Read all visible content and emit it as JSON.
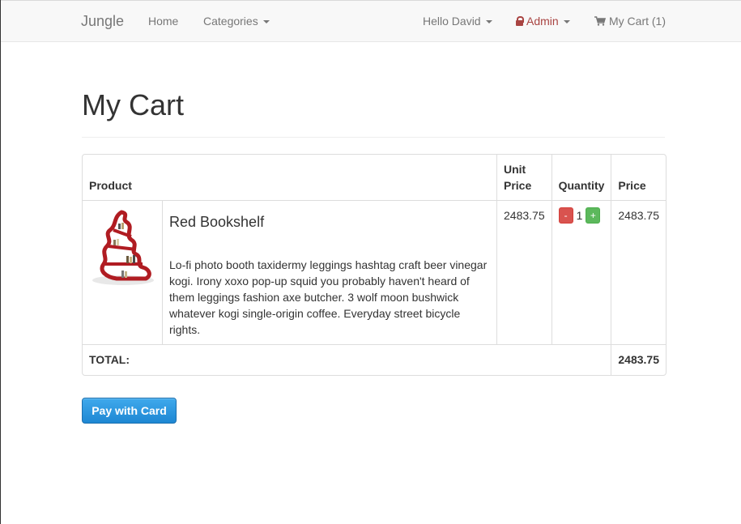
{
  "navbar": {
    "brand": "Jungle",
    "home": "Home",
    "categories": "Categories",
    "hello": "Hello David",
    "admin": "Admin",
    "cart": "My Cart (1)"
  },
  "page": {
    "title": "My Cart"
  },
  "table": {
    "headers": {
      "product": "Product",
      "unit_price": "Unit Price",
      "quantity": "Quantity",
      "price": "Price"
    },
    "items": [
      {
        "name": "Red Bookshelf",
        "description": "Lo-fi photo booth taxidermy leggings hashtag craft beer vinegar kogi. Irony xoxo pop-up squid you probably haven't heard of them leggings fashion axe butcher. 3 wolf moon bushwick whatever kogi single-origin coffee. Everyday street bicycle rights.",
        "unit_price": "2483.75",
        "quantity": "1",
        "price": "2483.75",
        "minus": "-",
        "plus": "+"
      }
    ],
    "total_label": "TOTAL:",
    "total_value": "2483.75"
  },
  "actions": {
    "pay_button": "Pay with Card"
  },
  "colors": {
    "admin_red": "#a94442",
    "danger": "#d9534f",
    "success": "#5cb85c",
    "pay_blue": "#1e87d3"
  }
}
